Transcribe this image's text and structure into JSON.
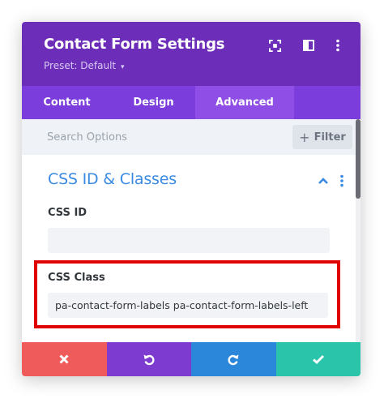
{
  "header": {
    "title": "Contact Form Settings",
    "preset_label": "Preset: Default",
    "preset_caret": "▾",
    "icons": [
      "focus-icon",
      "split-view-icon",
      "more-vertical-icon"
    ]
  },
  "tabs": [
    {
      "label": "Content",
      "active": false
    },
    {
      "label": "Design",
      "active": false
    },
    {
      "label": "Advanced",
      "active": true
    }
  ],
  "search": {
    "placeholder": "Search Options",
    "filter_label": "Filter",
    "filter_icon": "plus-icon"
  },
  "section": {
    "title": "CSS ID & Classes",
    "icons": [
      "chevron-up-icon",
      "more-vertical-icon"
    ]
  },
  "fields": {
    "css_id": {
      "label": "CSS ID",
      "value": ""
    },
    "css_class": {
      "label": "CSS Class",
      "value": "pa-contact-form-labels pa-contact-form-labels-left"
    }
  },
  "footer": {
    "buttons": [
      {
        "action": "cancel",
        "icon": "close-icon",
        "color": "#ef5a5a"
      },
      {
        "action": "undo",
        "icon": "undo-icon",
        "color": "#7e3bd0"
      },
      {
        "action": "redo",
        "icon": "redo-icon",
        "color": "#2b87da"
      },
      {
        "action": "save",
        "icon": "check-icon",
        "color": "#29c4a9"
      }
    ]
  },
  "colors": {
    "header_bg": "#6c2eb9",
    "tabs_bg": "#7b3ddb",
    "active_tab_bg": "#8f4ee6",
    "section_title": "#3a8ae2",
    "highlight_border": "#e00000"
  }
}
